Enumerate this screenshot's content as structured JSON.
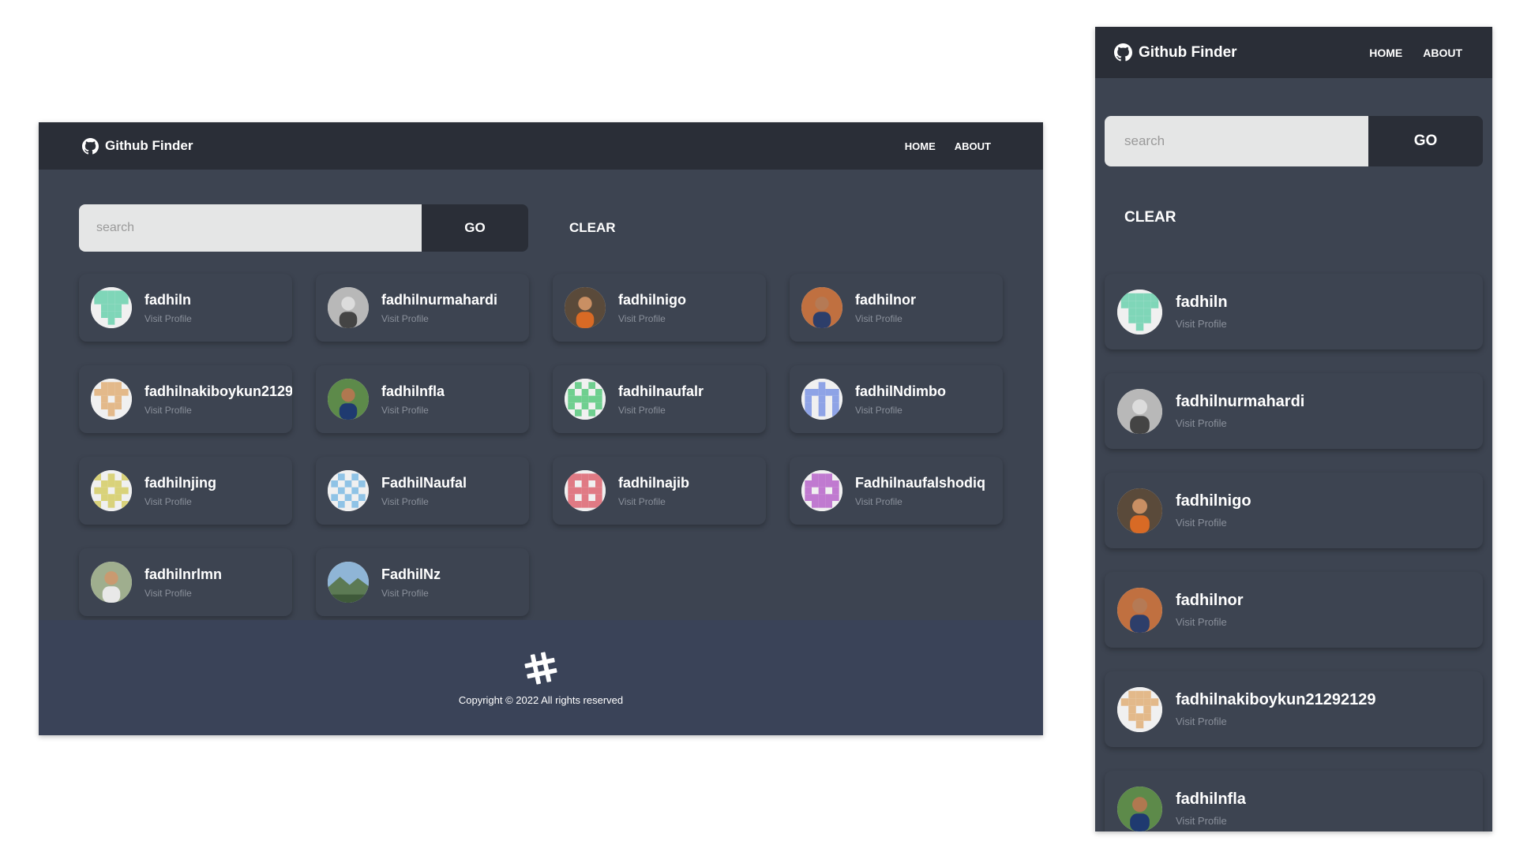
{
  "app": {
    "brand_name": "Github Finder",
    "nav": [
      {
        "label": "HOME"
      },
      {
        "label": "ABOUT"
      }
    ]
  },
  "search": {
    "placeholder": "search",
    "go_label": "GO",
    "clear_label": "CLEAR"
  },
  "users": [
    {
      "login": "fadhiln",
      "link_text": "Visit Profile",
      "avatar": "identicon-green-t"
    },
    {
      "login": "fadhilnurmahardi",
      "link_text": "Visit Profile",
      "avatar": "photo-grayscale-person"
    },
    {
      "login": "fadhilnigo",
      "link_text": "Visit Profile",
      "avatar": "photo-orange-person"
    },
    {
      "login": "fadhilnor",
      "link_text": "Visit Profile",
      "avatar": "photo-portrait-person"
    },
    {
      "login": "fadhilnakiboykun21292129",
      "link_text": "Visit Profile",
      "avatar": "identicon-tan"
    },
    {
      "login": "fadhilnfla",
      "link_text": "Visit Profile",
      "avatar": "photo-outdoor-person"
    },
    {
      "login": "fadhilnaufalr",
      "link_text": "Visit Profile",
      "avatar": "identicon-green-cross"
    },
    {
      "login": "fadhilNdimbo",
      "link_text": "Visit Profile",
      "avatar": "identicon-blue"
    },
    {
      "login": "fadhilnjing",
      "link_text": "Visit Profile",
      "avatar": "identicon-yellow"
    },
    {
      "login": "FadhilNaufal",
      "link_text": "Visit Profile",
      "avatar": "identicon-lightblue"
    },
    {
      "login": "fadhilnajib",
      "link_text": "Visit Profile",
      "avatar": "identicon-red"
    },
    {
      "login": "Fadhilnaufalshodiq",
      "link_text": "Visit Profile",
      "avatar": "identicon-purple"
    },
    {
      "login": "fadhilnrlmn",
      "link_text": "Visit Profile",
      "avatar": "photo-standing-person"
    },
    {
      "login": "FadhilNz",
      "link_text": "Visit Profile",
      "avatar": "photo-landscape"
    }
  ],
  "mobile_visible_users": [
    0,
    1,
    2,
    3,
    4,
    5
  ],
  "footer": {
    "logo_icon": "hash-logo-icon",
    "copyright": "Copyright © 2022 All rights reserved"
  },
  "colors": {
    "navbar_bg": "#2a2e37",
    "page_bg": "#3d4451",
    "footer_bg": "#3a4358",
    "input_bg": "#e5e6e6",
    "muted_text": "#8a909b"
  }
}
